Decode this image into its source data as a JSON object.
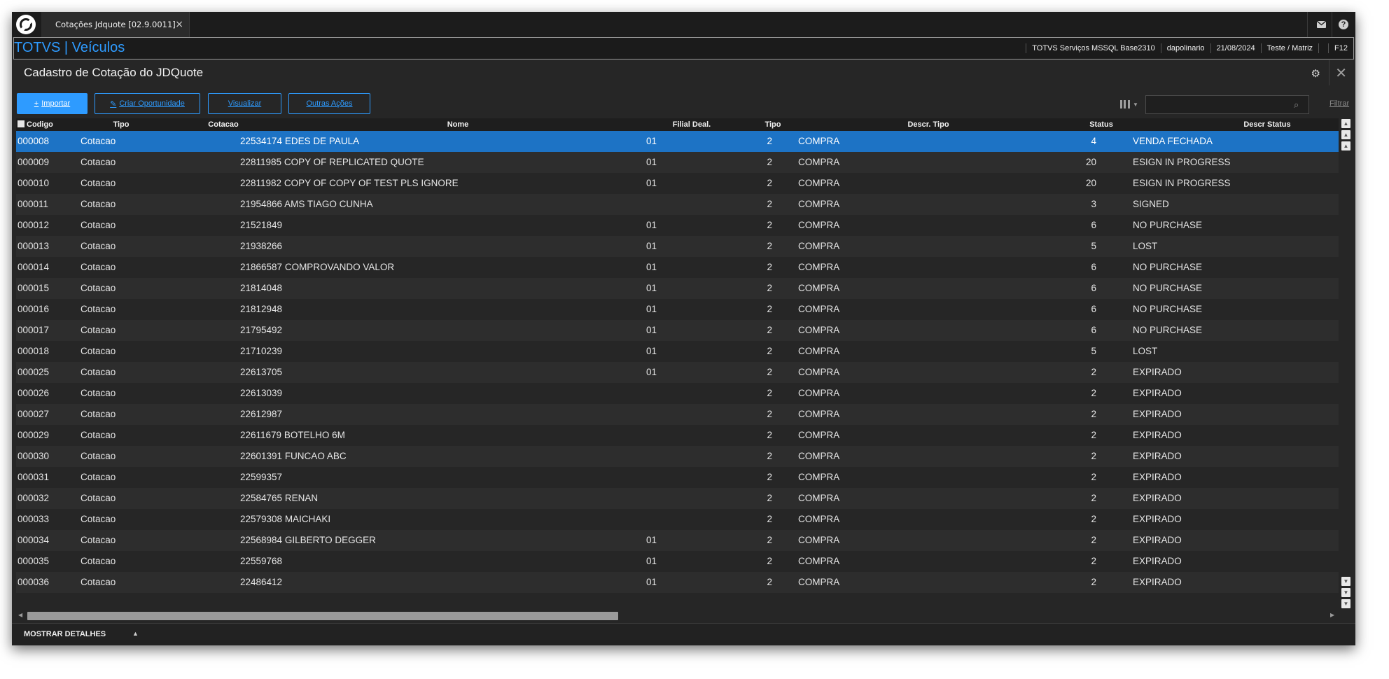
{
  "tab": {
    "title": "Cotações Jdquote [02.9.0011]",
    "close_icon": "×"
  },
  "brand": {
    "name": "TOTVS | Veículos"
  },
  "session": {
    "environment": "TOTVS Serviços MSSQL Base2310",
    "user": "dapolinario",
    "date": "21/08/2024",
    "branch": "Teste / Matriz",
    "shortcut": "F12"
  },
  "page": {
    "title": "Cadastro de Cotação do JDQuote"
  },
  "toolbar": {
    "import_label": "Importar",
    "create_opportunity_label": "Criar Oportunidade",
    "view_label": "Visualizar",
    "other_actions_label": "Outras Ações",
    "search_value": "",
    "filter_label": "Filtrar"
  },
  "table": {
    "headers": {
      "codigo": "Codigo",
      "tipo": "Tipo",
      "cotacao": "Cotacao",
      "nome": "Nome",
      "filial": "Filial Deal.",
      "tipo2": "Tipo",
      "descr_tipo": "Descr. Tipo",
      "status": "Status",
      "descr_status": "Descr Status"
    },
    "rows": [
      {
        "codigo": "000008",
        "tipo": "Cotacao",
        "cotacao": "22534174 EDES DE PAULA",
        "filial": "01",
        "tipo2": "2",
        "descr_tipo": "COMPRA",
        "status": "4",
        "descr_status": "VENDA FECHADA"
      },
      {
        "codigo": "000009",
        "tipo": "Cotacao",
        "cotacao": "22811985 COPY OF REPLICATED QUOTE",
        "filial": "01",
        "tipo2": "2",
        "descr_tipo": "COMPRA",
        "status": "20",
        "descr_status": "ESIGN IN PROGRESS"
      },
      {
        "codigo": "000010",
        "tipo": "Cotacao",
        "cotacao": "22811982 COPY OF COPY OF TEST PLS IGNORE",
        "filial": "01",
        "tipo2": "2",
        "descr_tipo": "COMPRA",
        "status": "20",
        "descr_status": "ESIGN IN PROGRESS"
      },
      {
        "codigo": "000011",
        "tipo": "Cotacao",
        "cotacao": "21954866 AMS TIAGO CUNHA",
        "filial": "",
        "tipo2": "2",
        "descr_tipo": "COMPRA",
        "status": "3",
        "descr_status": "SIGNED"
      },
      {
        "codigo": "000012",
        "tipo": "Cotacao",
        "cotacao": "21521849",
        "filial": "01",
        "tipo2": "2",
        "descr_tipo": "COMPRA",
        "status": "6",
        "descr_status": "NO PURCHASE"
      },
      {
        "codigo": "000013",
        "tipo": "Cotacao",
        "cotacao": "21938266",
        "filial": "01",
        "tipo2": "2",
        "descr_tipo": "COMPRA",
        "status": "5",
        "descr_status": "LOST"
      },
      {
        "codigo": "000014",
        "tipo": "Cotacao",
        "cotacao": "21866587 COMPROVANDO VALOR",
        "filial": "01",
        "tipo2": "2",
        "descr_tipo": "COMPRA",
        "status": "6",
        "descr_status": "NO PURCHASE"
      },
      {
        "codigo": "000015",
        "tipo": "Cotacao",
        "cotacao": "21814048",
        "filial": "01",
        "tipo2": "2",
        "descr_tipo": "COMPRA",
        "status": "6",
        "descr_status": "NO PURCHASE"
      },
      {
        "codigo": "000016",
        "tipo": "Cotacao",
        "cotacao": "21812948",
        "filial": "01",
        "tipo2": "2",
        "descr_tipo": "COMPRA",
        "status": "6",
        "descr_status": "NO PURCHASE"
      },
      {
        "codigo": "000017",
        "tipo": "Cotacao",
        "cotacao": "21795492",
        "filial": "01",
        "tipo2": "2",
        "descr_tipo": "COMPRA",
        "status": "6",
        "descr_status": "NO PURCHASE"
      },
      {
        "codigo": "000018",
        "tipo": "Cotacao",
        "cotacao": "21710239",
        "filial": "01",
        "tipo2": "2",
        "descr_tipo": "COMPRA",
        "status": "5",
        "descr_status": "LOST"
      },
      {
        "codigo": "000025",
        "tipo": "Cotacao",
        "cotacao": "22613705",
        "filial": "01",
        "tipo2": "2",
        "descr_tipo": "COMPRA",
        "status": "2",
        "descr_status": "EXPIRADO"
      },
      {
        "codigo": "000026",
        "tipo": "Cotacao",
        "cotacao": "22613039",
        "filial": "",
        "tipo2": "2",
        "descr_tipo": "COMPRA",
        "status": "2",
        "descr_status": "EXPIRADO"
      },
      {
        "codigo": "000027",
        "tipo": "Cotacao",
        "cotacao": "22612987",
        "filial": "",
        "tipo2": "2",
        "descr_tipo": "COMPRA",
        "status": "2",
        "descr_status": "EXPIRADO"
      },
      {
        "codigo": "000029",
        "tipo": "Cotacao",
        "cotacao": "22611679 BOTELHO 6M",
        "filial": "",
        "tipo2": "2",
        "descr_tipo": "COMPRA",
        "status": "2",
        "descr_status": "EXPIRADO"
      },
      {
        "codigo": "000030",
        "tipo": "Cotacao",
        "cotacao": "22601391 FUNCAO ABC",
        "filial": "",
        "tipo2": "2",
        "descr_tipo": "COMPRA",
        "status": "2",
        "descr_status": "EXPIRADO"
      },
      {
        "codigo": "000031",
        "tipo": "Cotacao",
        "cotacao": "22599357",
        "filial": "",
        "tipo2": "2",
        "descr_tipo": "COMPRA",
        "status": "2",
        "descr_status": "EXPIRADO"
      },
      {
        "codigo": "000032",
        "tipo": "Cotacao",
        "cotacao": "22584765 RENAN",
        "filial": "",
        "tipo2": "2",
        "descr_tipo": "COMPRA",
        "status": "2",
        "descr_status": "EXPIRADO"
      },
      {
        "codigo": "000033",
        "tipo": "Cotacao",
        "cotacao": "22579308 MAICHAKI",
        "filial": "",
        "tipo2": "2",
        "descr_tipo": "COMPRA",
        "status": "2",
        "descr_status": "EXPIRADO"
      },
      {
        "codigo": "000034",
        "tipo": "Cotacao",
        "cotacao": "22568984 GILBERTO DEGGER",
        "filial": "01",
        "tipo2": "2",
        "descr_tipo": "COMPRA",
        "status": "2",
        "descr_status": "EXPIRADO"
      },
      {
        "codigo": "000035",
        "tipo": "Cotacao",
        "cotacao": "22559768",
        "filial": "01",
        "tipo2": "2",
        "descr_tipo": "COMPRA",
        "status": "2",
        "descr_status": "EXPIRADO"
      },
      {
        "codigo": "000036",
        "tipo": "Cotacao",
        "cotacao": "22486412",
        "filial": "01",
        "tipo2": "2",
        "descr_tipo": "COMPRA",
        "status": "2",
        "descr_status": "EXPIRADO"
      }
    ],
    "selected_index": 0
  },
  "footer": {
    "details_label": "MOSTRAR DETALHES"
  },
  "icons": {
    "app": "totvs-logo-icon",
    "mail": "mail-icon",
    "help": "help-icon",
    "settings": "gear-icon",
    "close": "close-icon",
    "columns": "columns-icon",
    "search": "search-icon"
  },
  "colors": {
    "accent": "#2e9bff",
    "selected_row": "#1d73c5",
    "background": "#262626"
  }
}
